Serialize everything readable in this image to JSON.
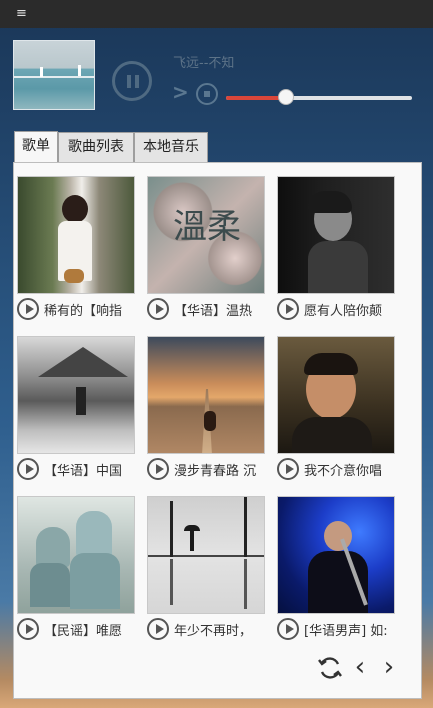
{
  "titlebar": {
    "menu_icon": "≡"
  },
  "player": {
    "song_title": "飞远--不知",
    "progress": 0.32,
    "colors": {
      "progress_fill": "#d9463a",
      "control": "#4f6a82"
    }
  },
  "tabs": [
    {
      "label": "歌单",
      "active": true
    },
    {
      "label": "歌曲列表",
      "active": false
    },
    {
      "label": "本地音乐",
      "active": false
    }
  ],
  "playlists": [
    {
      "title": "稀有的【响指",
      "image": "girl-in-white-dress"
    },
    {
      "title": "【华语】温热",
      "image": "flowers-wenrou"
    },
    {
      "title": "愿有人陪你颠",
      "image": "man-bw-portrait"
    },
    {
      "title": "【华语】中国",
      "image": "chinese-village-bw"
    },
    {
      "title": "漫步青春路 沉",
      "image": "road-guitar-sunset"
    },
    {
      "title": "我不介意你唱",
      "image": "man-smiling-portrait"
    },
    {
      "title": "【民谣】唯愿",
      "image": "two-hooded-people"
    },
    {
      "title": "年少不再时，",
      "image": "umbrella-reflection"
    },
    {
      "title": "[华语男声] 如:",
      "image": "singer-on-stage"
    }
  ],
  "pager": {
    "refresh_icon": "refresh-icon",
    "prev_glyph": "‹",
    "next_glyph": "›"
  }
}
